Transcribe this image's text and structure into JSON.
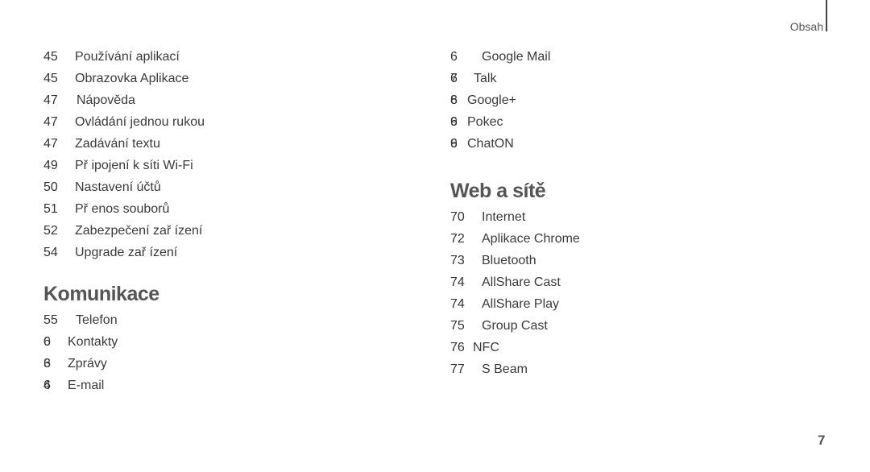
{
  "header": {
    "label": "Obsah"
  },
  "left_column": {
    "items_top": [
      {
        "page": "45",
        "title": "Používání aplikací",
        "indent": 0
      },
      {
        "page": "45",
        "title": "Obrazovka Aplikace",
        "indent": 0
      },
      {
        "page": "47",
        "title": "Nápověda",
        "indent": 2
      },
      {
        "page": "47",
        "title": "Ovládání jednou rukou",
        "indent": 0
      },
      {
        "page": "47",
        "title": "Zadávání textu",
        "indent": 0
      },
      {
        "page": "49",
        "title": "Př ipojení k síti Wi-Fi",
        "indent": 0
      },
      {
        "page": "50",
        "title": "Nastavení účtů",
        "indent": 0
      },
      {
        "page": "51",
        "title": "Př enos souborů",
        "indent": 0
      },
      {
        "page": "52",
        "title": "Zabezpečení zař ízení",
        "indent": 0
      },
      {
        "page": "54",
        "title": "Upgrade zař ízení",
        "indent": 0
      }
    ],
    "section_title": "Komunikace",
    "section_items": [
      {
        "page": "55",
        "title": "Telefon",
        "overlap": false
      },
      {
        "page": "60",
        "title": "Kontakty",
        "overlap": true,
        "glyphs": [
          "6",
          "0"
        ]
      },
      {
        "page": "63",
        "title": "Zprávy",
        "overlap": true,
        "glyphs": [
          "6",
          "3"
        ]
      },
      {
        "page": "64",
        "title": "E-mail",
        "overlap": true,
        "glyphs": [
          "6",
          "4"
        ]
      }
    ]
  },
  "right_column": {
    "items_top": [
      {
        "page": "6",
        "title": "Google Mail",
        "overlap": false
      },
      {
        "page": "67",
        "title": "Talk",
        "overlap": true,
        "glyphs": [
          "6",
          "7"
        ]
      },
      {
        "page": "68",
        "title": "Google+",
        "overlap": true,
        "glyphs": [
          "6",
          "8"
        ]
      },
      {
        "page": "69",
        "title": "Pokec",
        "overlap": true,
        "glyphs": [
          "6",
          "9"
        ]
      },
      {
        "page": "69",
        "title": "ChatON",
        "overlap": true,
        "glyphs": [
          "6",
          "9"
        ]
      }
    ],
    "section_title": "Web a sítě",
    "section_items": [
      {
        "page": "70",
        "title": "Internet"
      },
      {
        "page": "72",
        "title": "Aplikace Chrome"
      },
      {
        "page": "73",
        "title": "Bluetooth"
      },
      {
        "page": "74",
        "title": "AllShare Cast"
      },
      {
        "page": "74",
        "title": "AllShare Play"
      },
      {
        "page": "75",
        "title": "Group Cast"
      },
      {
        "page": "76",
        "title": "NFC"
      },
      {
        "page": "77",
        "title": "S Beam"
      }
    ]
  },
  "footer": {
    "page_number": "7"
  }
}
